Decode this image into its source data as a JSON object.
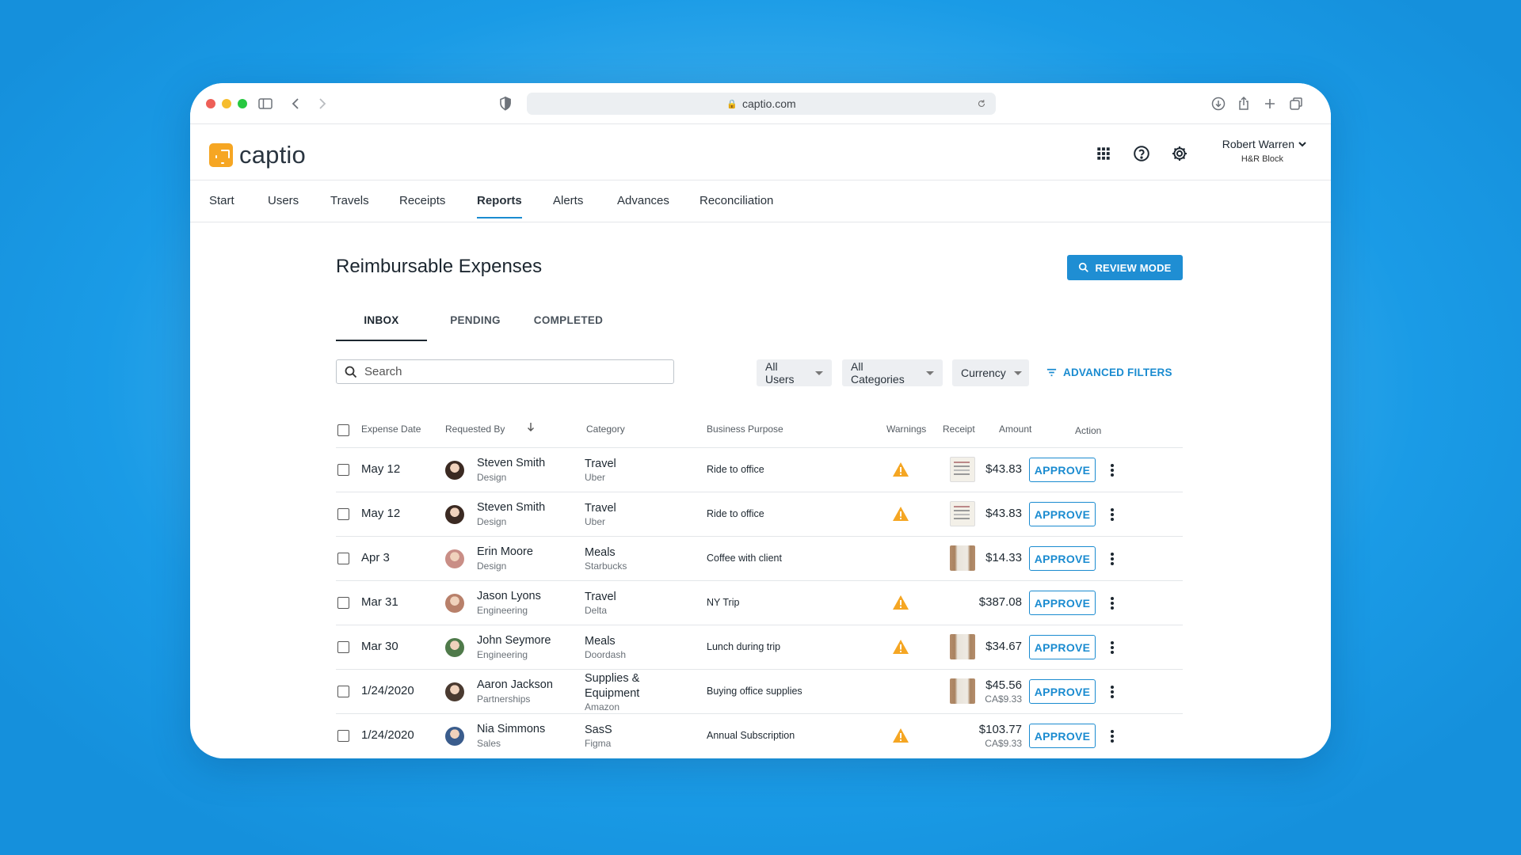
{
  "browser": {
    "url": "captio.com",
    "colors": {
      "close": "#ee5f57",
      "minimize": "#f6bd2e",
      "maximize": "#27c840"
    }
  },
  "app": {
    "logo_text": "captio",
    "brand_color": "#f6a623",
    "user": {
      "name": "Robert Warren",
      "org": "H&R Block"
    }
  },
  "nav": {
    "items": [
      {
        "label": "Start"
      },
      {
        "label": "Users"
      },
      {
        "label": "Travels"
      },
      {
        "label": "Receipts"
      },
      {
        "label": "Reports",
        "active": true
      },
      {
        "label": "Alerts"
      },
      {
        "label": "Advances"
      },
      {
        "label": "Reconciliation"
      }
    ]
  },
  "page": {
    "title": "Reimbursable Expenses",
    "review_button": "REVIEW MODE",
    "tabs": [
      {
        "label": "INBOX",
        "active": true
      },
      {
        "label": "PENDING"
      },
      {
        "label": "COMPLETED"
      }
    ],
    "search_placeholder": "Search",
    "filters": {
      "users": "All Users",
      "categories": "All Categories",
      "currency": "Currency",
      "advanced": "ADVANCED FILTERS"
    }
  },
  "table": {
    "headers": {
      "date": "Expense Date",
      "requested_by": "Requested By",
      "category": "Category",
      "purpose": "Business Purpose",
      "warnings": "Warnings",
      "receipt": "Receipt",
      "amount": "Amount",
      "action": "Action"
    },
    "approve_label": "APPROVE",
    "rows": [
      {
        "date": "May 12",
        "name": "Steven Smith",
        "dept": "Design",
        "category": "Travel",
        "vendor": "Uber",
        "purpose": "Ride to office",
        "warning": true,
        "receipt": "doc",
        "amount": "$43.83",
        "amount2": "",
        "avatar_color": "#3b2a22"
      },
      {
        "date": "May 12",
        "name": "Steven Smith",
        "dept": "Design",
        "category": "Travel",
        "vendor": "Uber",
        "purpose": "Ride to office",
        "warning": true,
        "receipt": "doc",
        "amount": "$43.83",
        "amount2": "",
        "avatar_color": "#3b2a22"
      },
      {
        "date": "Apr 3",
        "name": "Erin Moore",
        "dept": "Design",
        "category": "Meals",
        "vendor": "Starbucks",
        "purpose": "Coffee with client",
        "warning": false,
        "receipt": "photo",
        "amount": "$14.33",
        "amount2": "",
        "avatar_color": "#c98e86"
      },
      {
        "date": "Mar 31",
        "name": "Jason Lyons",
        "dept": "Engineering",
        "category": "Travel",
        "vendor": "Delta",
        "purpose": "NY Trip",
        "warning": true,
        "receipt": "",
        "amount": "$387.08",
        "amount2": "",
        "avatar_color": "#b8806a"
      },
      {
        "date": "Mar 30",
        "name": "John Seymore",
        "dept": "Engineering",
        "category": "Meals",
        "vendor": "Doordash",
        "purpose": "Lunch during trip",
        "warning": true,
        "receipt": "photo",
        "amount": "$34.67",
        "amount2": "",
        "avatar_color": "#4f7a4a"
      },
      {
        "date": "1/24/2020",
        "name": "Aaron Jackson",
        "dept": "Partnerships",
        "category": "Supplies &\nEquipment",
        "vendor": "Amazon",
        "purpose": "Buying office supplies",
        "warning": false,
        "receipt": "photo",
        "amount": "$45.56",
        "amount2": "CA$9.33",
        "avatar_color": "#4a3a30"
      },
      {
        "date": "1/24/2020",
        "name": "Nia Simmons",
        "dept": "Sales",
        "category": "SasS",
        "vendor": "Figma",
        "purpose": "Annual Subscription",
        "warning": true,
        "receipt": "",
        "amount": "$103.77",
        "amount2": "CA$9.33",
        "avatar_color": "#3a5c8c"
      }
    ]
  },
  "colors": {
    "accent": "#1a8bd0",
    "warning": "#f5a623",
    "review_button": "#1f8ed3"
  }
}
